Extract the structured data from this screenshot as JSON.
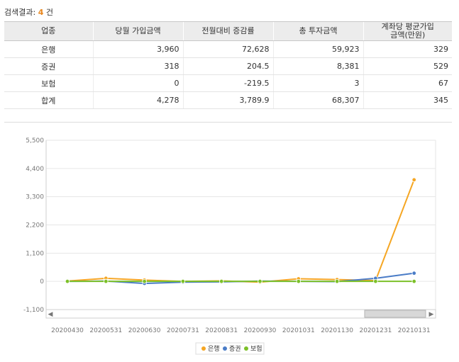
{
  "search_result": {
    "label": "검색결과:",
    "count": "4",
    "unit": "건"
  },
  "table": {
    "headers": [
      "업종",
      "당월 가입금액",
      "전월대비 증감률",
      "총 투자금액",
      "계좌당 평균가입\n금액(만원)"
    ],
    "rows": [
      [
        "은행",
        "3,960",
        "72,628",
        "59,923",
        "329"
      ],
      [
        "증권",
        "318",
        "204.5",
        "8,381",
        "529"
      ],
      [
        "보험",
        "0",
        "-219.5",
        "3",
        "67"
      ],
      [
        "합계",
        "4,278",
        "3,789.9",
        "68,307",
        "345"
      ]
    ]
  },
  "chart_data": {
    "type": "line",
    "categories": [
      "20200430",
      "20200531",
      "20200630",
      "20200731",
      "20200831",
      "20200930",
      "20201031",
      "20201130",
      "20201231",
      "20210131"
    ],
    "series": [
      {
        "name": "은행",
        "color": "#f5a623",
        "values": [
          10,
          120,
          50,
          0,
          20,
          -30,
          100,
          70,
          30,
          3960
        ]
      },
      {
        "name": "증권",
        "color": "#4a7cc7",
        "values": [
          0,
          10,
          -80,
          -30,
          -20,
          10,
          0,
          -10,
          120,
          318
        ]
      },
      {
        "name": "보험",
        "color": "#7cc028",
        "values": [
          0,
          0,
          0,
          0,
          0,
          0,
          0,
          0,
          0,
          0
        ]
      }
    ],
    "y_ticks": [
      "5,500",
      "4,400",
      "3,300",
      "2,200",
      "1,100",
      "0",
      "-1,100"
    ],
    "ylim": [
      -1100,
      5500
    ],
    "grid": true,
    "legend_position": "bottom-center",
    "scrollbar": {
      "left_arrow": "◀",
      "right_arrow": "▶"
    }
  }
}
